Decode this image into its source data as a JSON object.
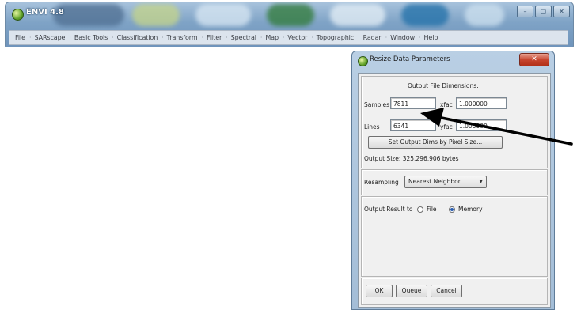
{
  "app": {
    "title": "ENVI 4.8",
    "window_buttons": {
      "minimize": "–",
      "maximize": "▢",
      "close": "✕"
    },
    "menu": [
      "File",
      "SARscape",
      "Basic Tools",
      "Classification",
      "Transform",
      "Filter",
      "Spectral",
      "Map",
      "Vector",
      "Topographic",
      "Radar",
      "Window",
      "Help"
    ]
  },
  "dialog": {
    "title": "Resize Data Parameters",
    "close_label": "✕",
    "output_dims_heading": "Output File Dimensions:",
    "samples_label": "Samples",
    "samples_value": "7811",
    "xfac_label": "xfac",
    "xfac_value": "1.000000",
    "lines_label": "Lines",
    "lines_value": "6341",
    "yfac_label": "yfac",
    "yfac_value": "1.000000",
    "set_dims_button": "Set Output Dims by Pixel Size...",
    "output_size": "Output Size: 325,296,906 bytes",
    "resampling_label": "Resampling",
    "resampling_value": "Nearest Neighbor",
    "output_result_label": "Output Result to",
    "option_file": "File",
    "option_memory": "Memory",
    "selected_output": "Memory",
    "buttons": {
      "ok": "OK",
      "queue": "Queue",
      "cancel": "Cancel"
    }
  },
  "colors": {
    "titlebar": "#7fa3c6",
    "dialog_frame": "#a3bdd7",
    "close_red": "#c7452f",
    "arrow": "#000000"
  }
}
